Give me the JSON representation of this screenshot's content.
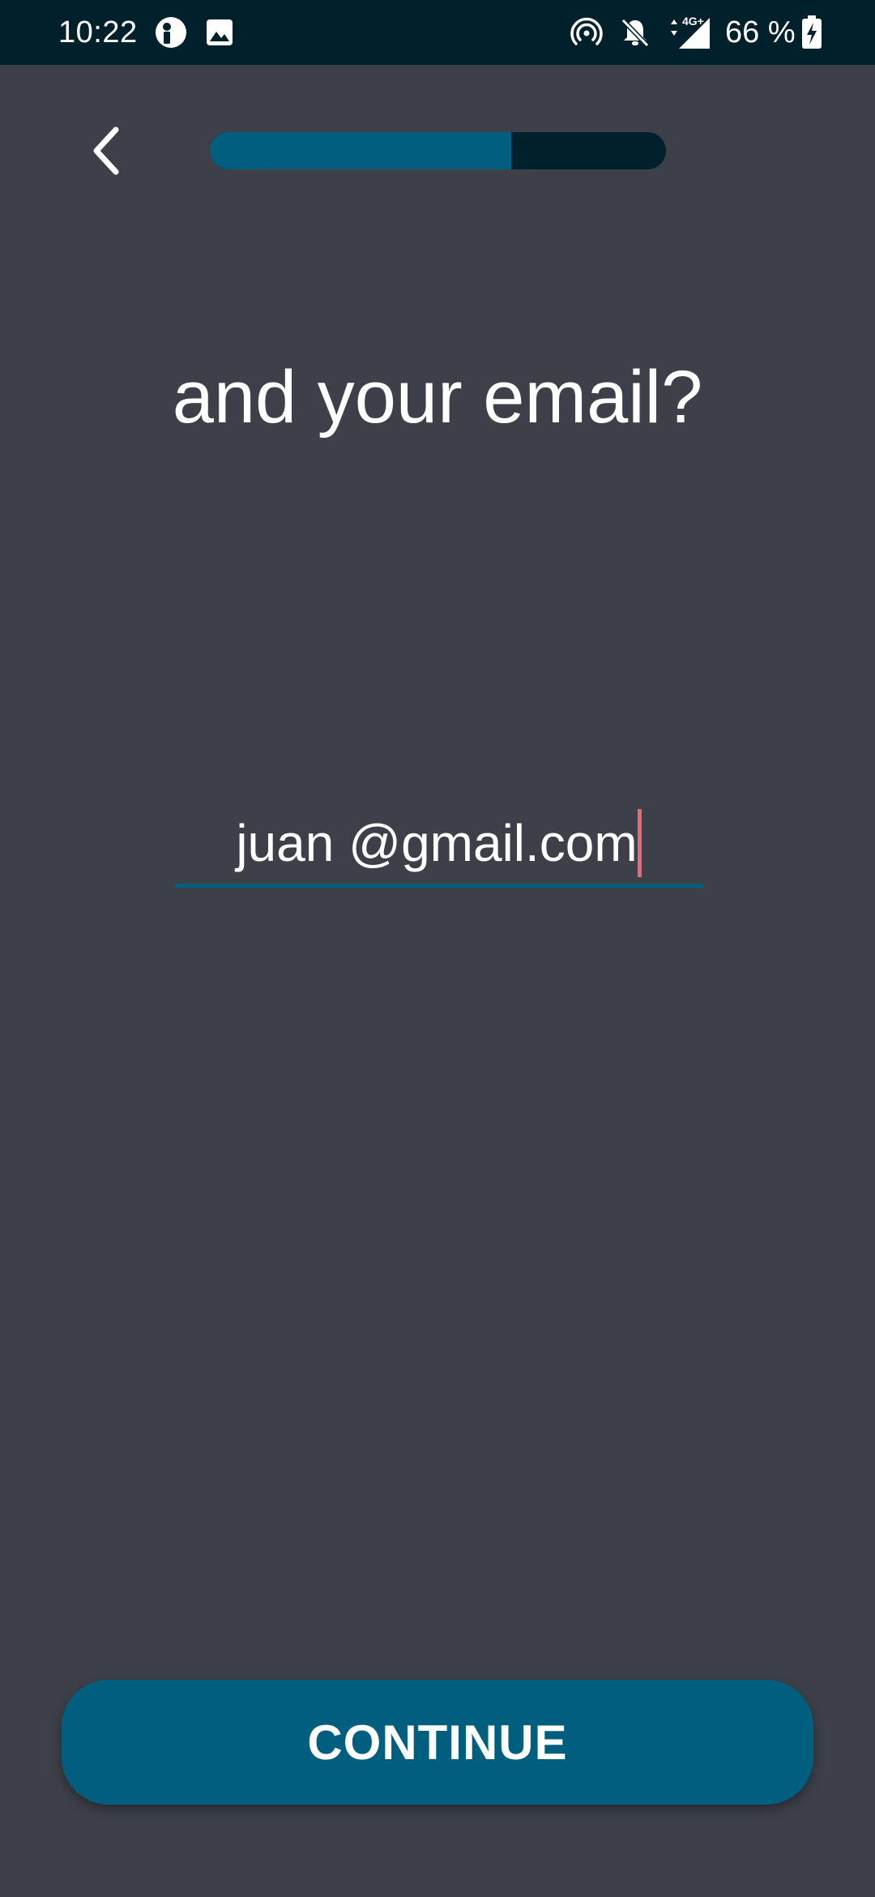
{
  "status_bar": {
    "time": "10:22",
    "battery_text": "66 %",
    "network_label": "4G+",
    "icons": [
      "app-notification-icon",
      "image-notification-icon",
      "hotspot-icon",
      "notifications-off-icon",
      "mobile-signal-icon",
      "battery-charging-icon"
    ]
  },
  "progress": {
    "fraction": 0.66
  },
  "question": {
    "text": "and your email?"
  },
  "email_input": {
    "value": "juan @gmail.com"
  },
  "continue_button": {
    "label": "CONTINUE"
  },
  "colors": {
    "background": "#3e4049",
    "status_bar": "#00202c",
    "accent": "#005f7f",
    "cursor": "#e66a77",
    "text": "#ffffff"
  }
}
